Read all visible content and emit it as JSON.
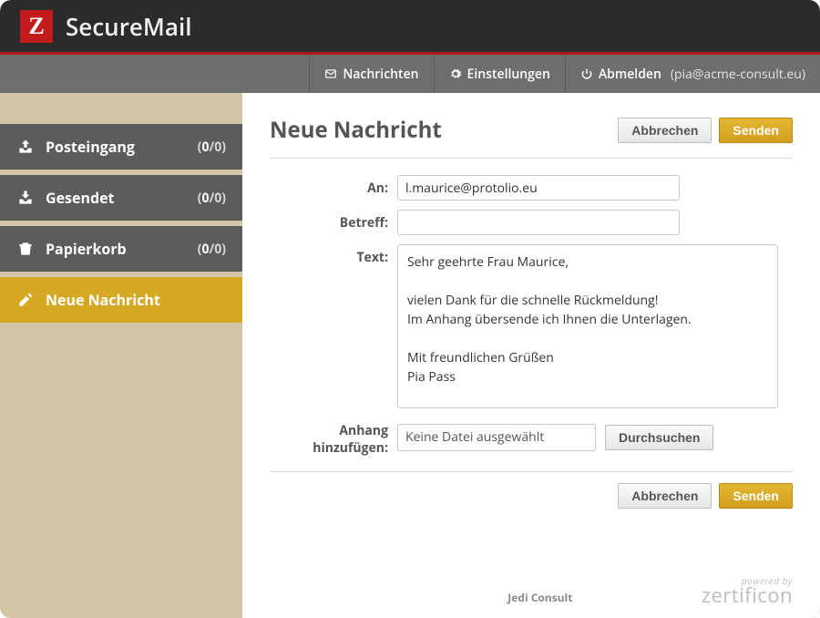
{
  "app": {
    "title": "SecureMail",
    "logo_letter": "Z"
  },
  "topnav": {
    "messages": "Nachrichten",
    "settings": "Einstellungen",
    "logout": "Abmelden",
    "user_email": "(pia@acme-consult.eu)"
  },
  "sidebar": {
    "items": [
      {
        "label": "Posteingang",
        "count_bold": "0",
        "count_rest": "/0)"
      },
      {
        "label": "Gesendet",
        "count_bold": "0",
        "count_rest": "/0)"
      },
      {
        "label": "Papierkorb",
        "count_bold": "0",
        "count_rest": "/0)"
      },
      {
        "label": "Neue Nachricht"
      }
    ]
  },
  "main": {
    "title": "Neue Nachricht",
    "cancel": "Abbrechen",
    "send": "Senden"
  },
  "form": {
    "to_label": "An:",
    "to_value": "l.maurice@protolio.eu",
    "subject_label": "Betreff:",
    "subject_value": "",
    "body_label": "Text:",
    "body_value": "Sehr geehrte Frau Maurice,\n\nvielen Dank für die schnelle Rückmeldung!\nIm Anhang übersende ich Ihnen die Unterlagen.\n\nMit freundlichen Grüßen\nPia Pass",
    "attach_label": "Anhang hinzufügen:",
    "attach_display": "Keine Datei ausgewählt",
    "browse": "Durchsuchen"
  },
  "footer": {
    "center": "Jedi Consult",
    "powered_small": "powered by",
    "powered_brand": "zertificon"
  }
}
